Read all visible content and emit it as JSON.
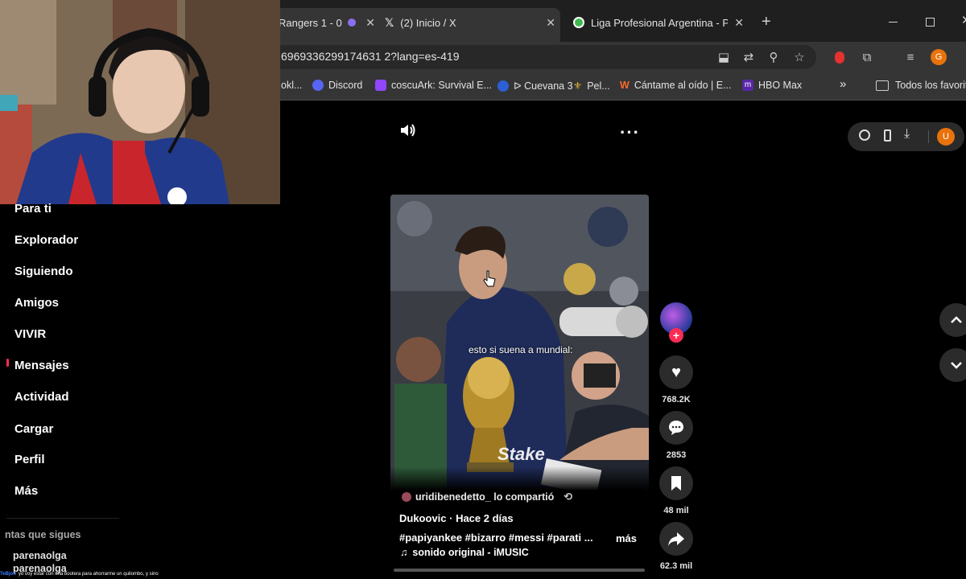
{
  "browser": {
    "tabs": [
      {
        "label": "Rangers 1 - 0",
        "close": "✕"
      },
      {
        "label": "(2) Inicio / X",
        "close": "✕"
      },
      {
        "label": "Liga Profesional Argentina - PO",
        "close": "✕"
      }
    ],
    "new_tab": "+",
    "url": "6969336299174631 2?lang=es-419",
    "profile_initial": "G",
    "bookmarks": [
      {
        "label": "okl..."
      },
      {
        "label": "Discord"
      },
      {
        "label": "coscuArk: Survival E..."
      },
      {
        "label": "ᐅ Cuevana 3"
      },
      {
        "label": "Pel..."
      },
      {
        "label": "Cántame al oído | E..."
      },
      {
        "label": "HBO Max"
      },
      {
        "label": "Todos los favorito"
      }
    ],
    "bookmarks_more": "»"
  },
  "sidebar": {
    "items": [
      {
        "label": "Para ti"
      },
      {
        "label": "Explorador"
      },
      {
        "label": "Siguiendo"
      },
      {
        "label": "Amigos"
      },
      {
        "label": "VIVIR"
      },
      {
        "label": "Mensajes"
      },
      {
        "label": "Actividad"
      },
      {
        "label": "Cargar"
      },
      {
        "label": "Perfil"
      },
      {
        "label": "Más"
      }
    ],
    "following_title": "ntas que sigues",
    "following": [
      "parenaolga",
      "parenaolga"
    ]
  },
  "video": {
    "caption_overlay": "esto si suena a mundial:",
    "watermark": "Stake",
    "shared_by": "uridibenedetto_ lo compartió",
    "author_line": "Dukoovic · Hace 2 días",
    "hashtags": "#papiyankee #bizarro #messi #parati ...",
    "more": "más",
    "sound": "sonido original - iMUSIC"
  },
  "actions": {
    "likes": "768.2K",
    "comments": "2853",
    "saves": "48 mil",
    "shares": "62.3 mil"
  },
  "topright": {
    "avatar_initial": "U"
  },
  "chat_line": "yo voy estar con una bootera para ahorrarme un quilombo, y sino",
  "chat_user": "TeBjon"
}
